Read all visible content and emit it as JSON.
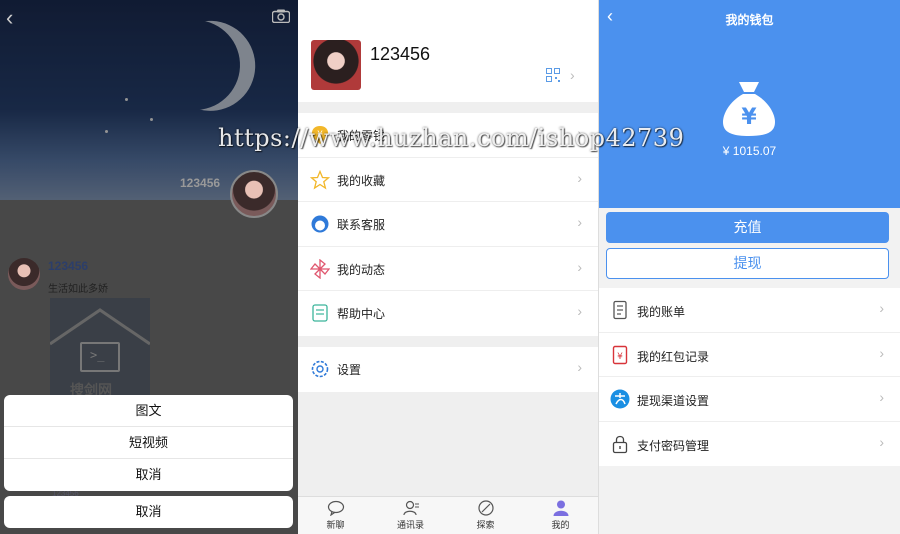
{
  "moments": {
    "cover_name": "123456",
    "post": {
      "name": "123456",
      "text": "生活如此多娇",
      "image_mark": "搜剑网"
    },
    "behind_text": "123456",
    "sheet": {
      "items": [
        "图文",
        "短视频",
        "取消"
      ],
      "cancel": "取消"
    }
  },
  "me": {
    "username": "123456",
    "group1": [
      {
        "label": "我的零钱",
        "icon": "wallet-icon"
      },
      {
        "label": "我的收藏",
        "icon": "star-icon"
      },
      {
        "label": "联系客服",
        "icon": "service-icon"
      },
      {
        "label": "我的动态",
        "icon": "pinwheel-icon"
      },
      {
        "label": "帮助中心",
        "icon": "help-icon"
      }
    ],
    "group2": [
      {
        "label": "设置",
        "icon": "gear-icon"
      }
    ],
    "tabs": [
      {
        "label": "新聊",
        "icon": "chat-bubble-icon"
      },
      {
        "label": "通讯录",
        "icon": "contacts-icon"
      },
      {
        "label": "探索",
        "icon": "compass-icon"
      },
      {
        "label": "我的",
        "icon": "person-icon",
        "active": true
      }
    ]
  },
  "wallet": {
    "title": "我的钱包",
    "balance": "¥ 1015.07",
    "currency_symbol": "¥",
    "recharge": "充值",
    "withdraw": "提现",
    "items": [
      {
        "label": "我的账单",
        "icon": "bill-icon"
      },
      {
        "label": "我的红包记录",
        "icon": "red-packet-icon"
      },
      {
        "label": "提现渠道设置",
        "icon": "alipay-icon"
      },
      {
        "label": "支付密码管理",
        "icon": "lock-icon"
      }
    ]
  },
  "watermark": "https://www.huzhan.com/ishop42739",
  "colors": {
    "accent": "#4b91ee",
    "page_bg": "#efefef"
  }
}
